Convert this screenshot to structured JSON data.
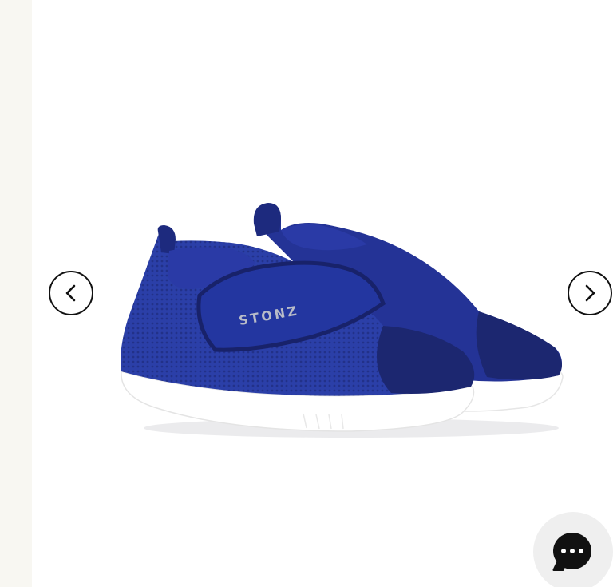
{
  "gallery": {
    "prev_icon": "chevron-left-icon",
    "next_icon": "chevron-right-icon",
    "product": {
      "brand_logo": "STONZ",
      "shoe_color": "#1f2f86",
      "sole_color": "#ffffff"
    }
  },
  "chat": {
    "icon": "chat-bubble-icon"
  }
}
